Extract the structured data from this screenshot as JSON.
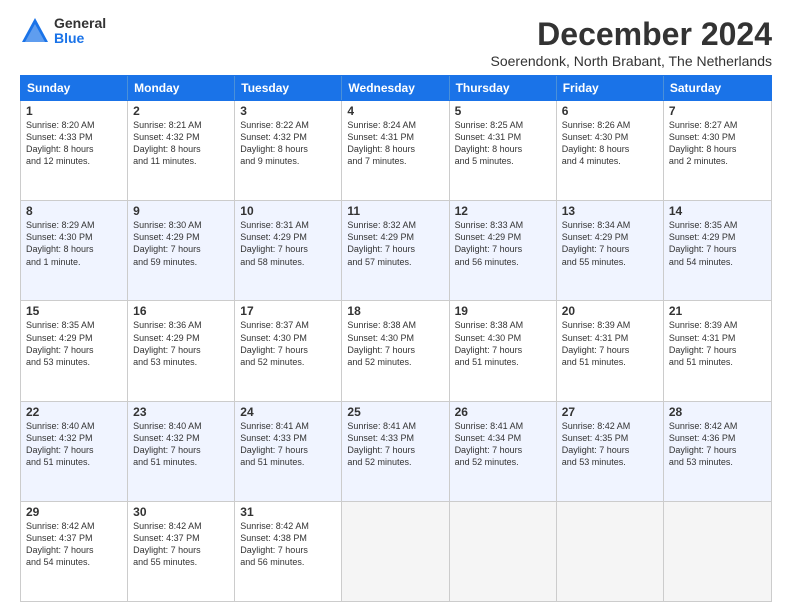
{
  "logo": {
    "general": "General",
    "blue": "Blue"
  },
  "title": "December 2024",
  "subtitle": "Soerendonk, North Brabant, The Netherlands",
  "header_days": [
    "Sunday",
    "Monday",
    "Tuesday",
    "Wednesday",
    "Thursday",
    "Friday",
    "Saturday"
  ],
  "weeks": [
    [
      {
        "day": "1",
        "lines": [
          "Sunrise: 8:20 AM",
          "Sunset: 4:33 PM",
          "Daylight: 8 hours",
          "and 12 minutes."
        ]
      },
      {
        "day": "2",
        "lines": [
          "Sunrise: 8:21 AM",
          "Sunset: 4:32 PM",
          "Daylight: 8 hours",
          "and 11 minutes."
        ]
      },
      {
        "day": "3",
        "lines": [
          "Sunrise: 8:22 AM",
          "Sunset: 4:32 PM",
          "Daylight: 8 hours",
          "and 9 minutes."
        ]
      },
      {
        "day": "4",
        "lines": [
          "Sunrise: 8:24 AM",
          "Sunset: 4:31 PM",
          "Daylight: 8 hours",
          "and 7 minutes."
        ]
      },
      {
        "day": "5",
        "lines": [
          "Sunrise: 8:25 AM",
          "Sunset: 4:31 PM",
          "Daylight: 8 hours",
          "and 5 minutes."
        ]
      },
      {
        "day": "6",
        "lines": [
          "Sunrise: 8:26 AM",
          "Sunset: 4:30 PM",
          "Daylight: 8 hours",
          "and 4 minutes."
        ]
      },
      {
        "day": "7",
        "lines": [
          "Sunrise: 8:27 AM",
          "Sunset: 4:30 PM",
          "Daylight: 8 hours",
          "and 2 minutes."
        ]
      }
    ],
    [
      {
        "day": "8",
        "lines": [
          "Sunrise: 8:29 AM",
          "Sunset: 4:30 PM",
          "Daylight: 8 hours",
          "and 1 minute."
        ]
      },
      {
        "day": "9",
        "lines": [
          "Sunrise: 8:30 AM",
          "Sunset: 4:29 PM",
          "Daylight: 7 hours",
          "and 59 minutes."
        ]
      },
      {
        "day": "10",
        "lines": [
          "Sunrise: 8:31 AM",
          "Sunset: 4:29 PM",
          "Daylight: 7 hours",
          "and 58 minutes."
        ]
      },
      {
        "day": "11",
        "lines": [
          "Sunrise: 8:32 AM",
          "Sunset: 4:29 PM",
          "Daylight: 7 hours",
          "and 57 minutes."
        ]
      },
      {
        "day": "12",
        "lines": [
          "Sunrise: 8:33 AM",
          "Sunset: 4:29 PM",
          "Daylight: 7 hours",
          "and 56 minutes."
        ]
      },
      {
        "day": "13",
        "lines": [
          "Sunrise: 8:34 AM",
          "Sunset: 4:29 PM",
          "Daylight: 7 hours",
          "and 55 minutes."
        ]
      },
      {
        "day": "14",
        "lines": [
          "Sunrise: 8:35 AM",
          "Sunset: 4:29 PM",
          "Daylight: 7 hours",
          "and 54 minutes."
        ]
      }
    ],
    [
      {
        "day": "15",
        "lines": [
          "Sunrise: 8:35 AM",
          "Sunset: 4:29 PM",
          "Daylight: 7 hours",
          "and 53 minutes."
        ]
      },
      {
        "day": "16",
        "lines": [
          "Sunrise: 8:36 AM",
          "Sunset: 4:29 PM",
          "Daylight: 7 hours",
          "and 53 minutes."
        ]
      },
      {
        "day": "17",
        "lines": [
          "Sunrise: 8:37 AM",
          "Sunset: 4:30 PM",
          "Daylight: 7 hours",
          "and 52 minutes."
        ]
      },
      {
        "day": "18",
        "lines": [
          "Sunrise: 8:38 AM",
          "Sunset: 4:30 PM",
          "Daylight: 7 hours",
          "and 52 minutes."
        ]
      },
      {
        "day": "19",
        "lines": [
          "Sunrise: 8:38 AM",
          "Sunset: 4:30 PM",
          "Daylight: 7 hours",
          "and 51 minutes."
        ]
      },
      {
        "day": "20",
        "lines": [
          "Sunrise: 8:39 AM",
          "Sunset: 4:31 PM",
          "Daylight: 7 hours",
          "and 51 minutes."
        ]
      },
      {
        "day": "21",
        "lines": [
          "Sunrise: 8:39 AM",
          "Sunset: 4:31 PM",
          "Daylight: 7 hours",
          "and 51 minutes."
        ]
      }
    ],
    [
      {
        "day": "22",
        "lines": [
          "Sunrise: 8:40 AM",
          "Sunset: 4:32 PM",
          "Daylight: 7 hours",
          "and 51 minutes."
        ]
      },
      {
        "day": "23",
        "lines": [
          "Sunrise: 8:40 AM",
          "Sunset: 4:32 PM",
          "Daylight: 7 hours",
          "and 51 minutes."
        ]
      },
      {
        "day": "24",
        "lines": [
          "Sunrise: 8:41 AM",
          "Sunset: 4:33 PM",
          "Daylight: 7 hours",
          "and 51 minutes."
        ]
      },
      {
        "day": "25",
        "lines": [
          "Sunrise: 8:41 AM",
          "Sunset: 4:33 PM",
          "Daylight: 7 hours",
          "and 52 minutes."
        ]
      },
      {
        "day": "26",
        "lines": [
          "Sunrise: 8:41 AM",
          "Sunset: 4:34 PM",
          "Daylight: 7 hours",
          "and 52 minutes."
        ]
      },
      {
        "day": "27",
        "lines": [
          "Sunrise: 8:42 AM",
          "Sunset: 4:35 PM",
          "Daylight: 7 hours",
          "and 53 minutes."
        ]
      },
      {
        "day": "28",
        "lines": [
          "Sunrise: 8:42 AM",
          "Sunset: 4:36 PM",
          "Daylight: 7 hours",
          "and 53 minutes."
        ]
      }
    ],
    [
      {
        "day": "29",
        "lines": [
          "Sunrise: 8:42 AM",
          "Sunset: 4:37 PM",
          "Daylight: 7 hours",
          "and 54 minutes."
        ]
      },
      {
        "day": "30",
        "lines": [
          "Sunrise: 8:42 AM",
          "Sunset: 4:37 PM",
          "Daylight: 7 hours",
          "and 55 minutes."
        ]
      },
      {
        "day": "31",
        "lines": [
          "Sunrise: 8:42 AM",
          "Sunset: 4:38 PM",
          "Daylight: 7 hours",
          "and 56 minutes."
        ]
      },
      {
        "day": "",
        "lines": []
      },
      {
        "day": "",
        "lines": []
      },
      {
        "day": "",
        "lines": []
      },
      {
        "day": "",
        "lines": []
      }
    ]
  ]
}
